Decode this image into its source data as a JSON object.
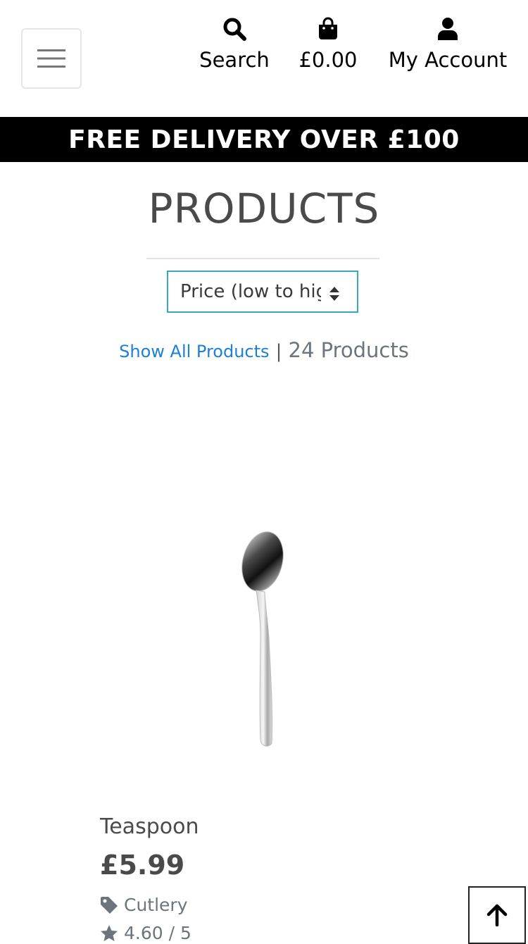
{
  "header": {
    "search_label": "Search",
    "bag_total": "£0.00",
    "account_label": "My Account"
  },
  "banner": {
    "text": "FREE DELIVERY OVER £100"
  },
  "page": {
    "title": "PRODUCTS"
  },
  "sort": {
    "selected": "Price (low to high)"
  },
  "listing": {
    "show_all": "Show All Products",
    "separator": "|",
    "count": "24 Products"
  },
  "product": {
    "name": "Teaspoon",
    "price": "£5.99",
    "category": "Cutlery",
    "rating": "4.60 / 5"
  },
  "colors": {
    "accent_border": "#36a9bd",
    "link": "#1a80d9",
    "banner_bg": "#000000"
  },
  "icons": [
    "hamburger-icon",
    "search-icon",
    "shopping-bag-icon",
    "user-icon",
    "sort-arrows-icon",
    "tag-icon",
    "star-icon",
    "arrow-up-icon"
  ]
}
